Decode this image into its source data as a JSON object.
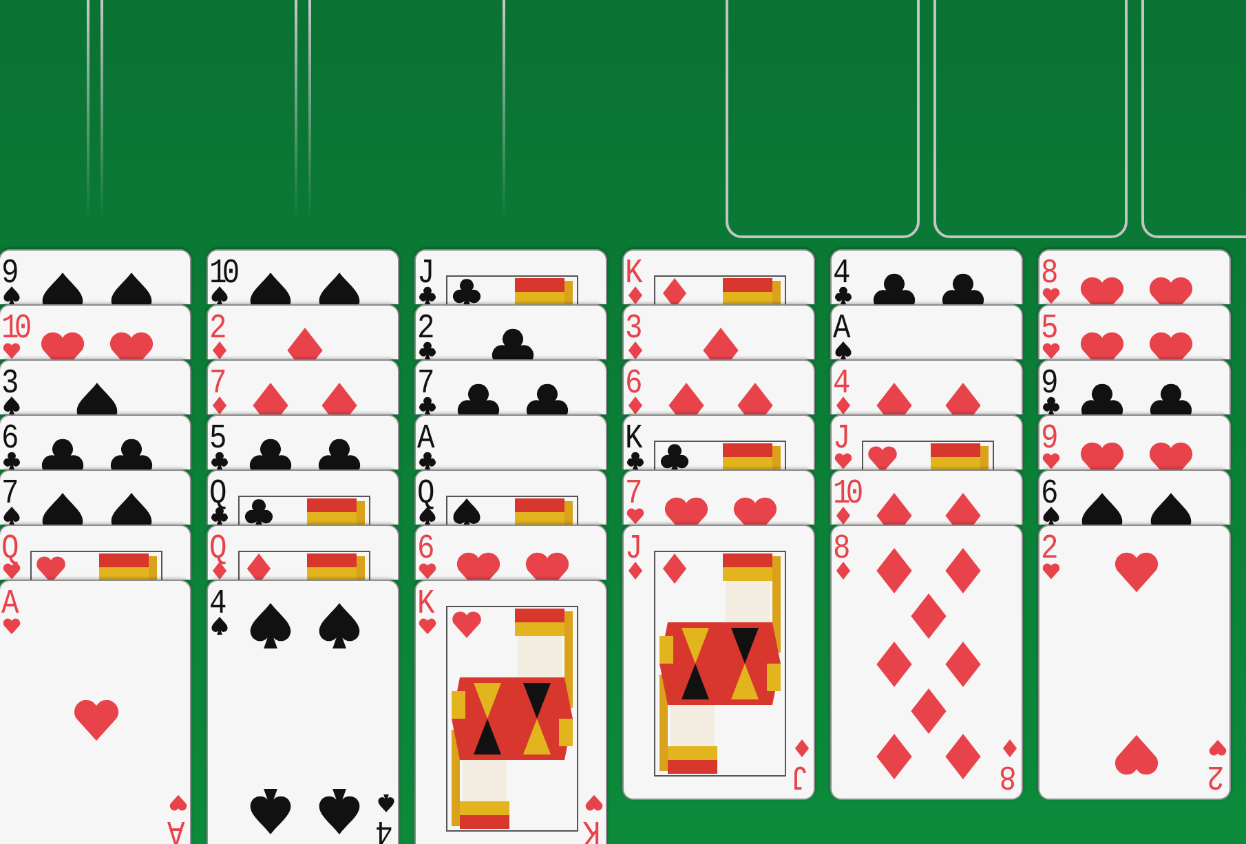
{
  "columns": [
    {
      "cards": [
        {
          "rank": "9",
          "kind": "spades",
          "pips": {
            "kind": "nine"
          }
        },
        {
          "rank": "10",
          "kind": "hearts",
          "pips": {
            "kind": "ten"
          }
        },
        {
          "rank": "3",
          "kind": "spades",
          "pips": {
            "kind": "three"
          }
        },
        {
          "rank": "6",
          "kind": "clubs",
          "pips": {
            "kind": "six"
          }
        },
        {
          "rank": "7",
          "kind": "spades",
          "pips": {
            "kind": "seven"
          }
        },
        {
          "rank": "Q",
          "kind": "hearts",
          "pips": {
            "kind": "face"
          }
        },
        {
          "rank": "A",
          "kind": "hearts",
          "pips": {
            "kind": "ace"
          },
          "corner_rank": "A"
        }
      ]
    },
    {
      "cards": [
        {
          "rank": "10",
          "kind": "spades",
          "pips": {
            "kind": "ten"
          }
        },
        {
          "rank": "2",
          "kind": "diamonds",
          "pips": {
            "kind": "two"
          }
        },
        {
          "rank": "7",
          "kind": "diamonds",
          "pips": {
            "kind": "seven"
          }
        },
        {
          "rank": "5",
          "kind": "clubs",
          "pips": {
            "kind": "five"
          }
        },
        {
          "rank": "Q",
          "kind": "clubs",
          "pips": {
            "kind": "face"
          }
        },
        {
          "rank": "Q",
          "kind": "diamonds",
          "pips": {
            "kind": "face"
          }
        },
        {
          "rank": "4",
          "kind": "spades",
          "pips": {
            "kind": "four"
          },
          "corner_rank": "4"
        }
      ]
    },
    {
      "cards": [
        {
          "rank": "J",
          "kind": "clubs",
          "pips": {
            "kind": "face"
          }
        },
        {
          "rank": "2",
          "kind": "clubs",
          "pips": {
            "kind": "two"
          }
        },
        {
          "rank": "7",
          "kind": "clubs",
          "pips": {
            "kind": "seven"
          }
        },
        {
          "rank": "A",
          "kind": "clubs",
          "pips": {
            "kind": "ace"
          }
        },
        {
          "rank": "Q",
          "kind": "spades",
          "pips": {
            "kind": "face"
          }
        },
        {
          "rank": "6",
          "kind": "hearts",
          "pips": {
            "kind": "six"
          }
        },
        {
          "rank": "K",
          "kind": "hearts",
          "pips": {
            "kind": "face"
          },
          "corner_rank": "K"
        }
      ]
    },
    {
      "cards": [
        {
          "rank": "K",
          "kind": "diamonds",
          "pips": {
            "kind": "face"
          }
        },
        {
          "rank": "3",
          "kind": "diamonds",
          "pips": {
            "kind": "three"
          }
        },
        {
          "rank": "6",
          "kind": "diamonds",
          "pips": {
            "kind": "six"
          }
        },
        {
          "rank": "K",
          "kind": "clubs",
          "pips": {
            "kind": "face"
          }
        },
        {
          "rank": "7",
          "kind": "hearts",
          "pips": {
            "kind": "seven"
          }
        },
        {
          "rank": "J",
          "kind": "diamonds",
          "pips": {
            "kind": "face"
          },
          "corner_rank": "J"
        }
      ]
    },
    {
      "cards": [
        {
          "rank": "4",
          "kind": "clubs",
          "pips": {
            "kind": "four"
          }
        },
        {
          "rank": "A",
          "kind": "spades",
          "pips": {
            "kind": "ace"
          }
        },
        {
          "rank": "4",
          "kind": "diamonds",
          "pips": {
            "kind": "four"
          }
        },
        {
          "rank": "J",
          "kind": "hearts",
          "pips": {
            "kind": "face"
          }
        },
        {
          "rank": "10",
          "kind": "diamonds",
          "pips": {
            "kind": "ten"
          }
        },
        {
          "rank": "8",
          "kind": "diamonds",
          "pips": {
            "kind": "eight"
          },
          "corner_rank": "8"
        }
      ]
    },
    {
      "cards": [
        {
          "rank": "8",
          "kind": "hearts",
          "pips": {
            "kind": "eight"
          }
        },
        {
          "rank": "5",
          "kind": "hearts",
          "pips": {
            "kind": "five"
          }
        },
        {
          "rank": "9",
          "kind": "clubs",
          "pips": {
            "kind": "nine"
          }
        },
        {
          "rank": "9",
          "kind": "hearts",
          "pips": {
            "kind": "nine"
          }
        },
        {
          "rank": "6",
          "kind": "spades",
          "pips": {
            "kind": "six"
          }
        },
        {
          "rank": "2",
          "kind": "hearts",
          "pips": {
            "kind": "two"
          },
          "corner_rank": "2"
        }
      ]
    }
  ]
}
